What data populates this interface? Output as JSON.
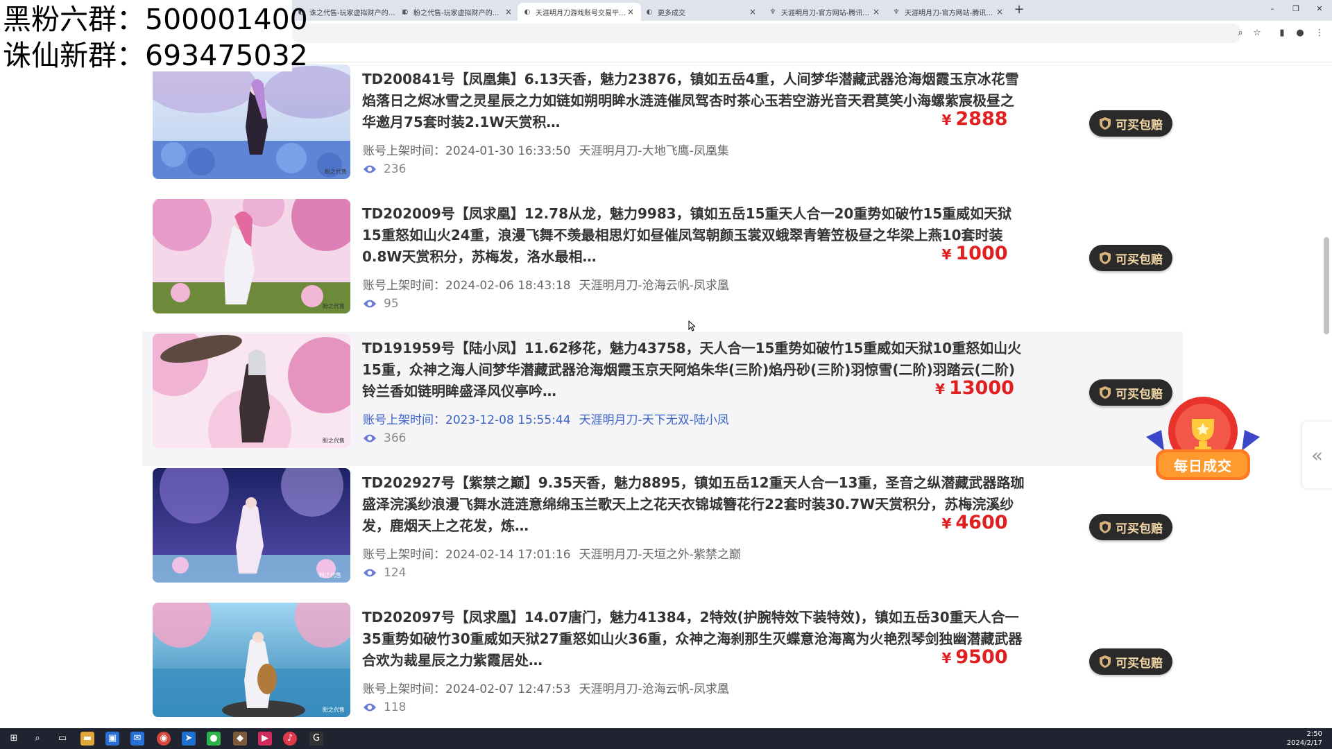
{
  "browser": {
    "tabs": [
      {
        "title": "诛之代售-玩家虚拟财产的守护者",
        "active": false
      },
      {
        "title": "盼之代售-玩家虚拟财产的守护者",
        "active": false
      },
      {
        "title": "天涯明月刀游戏账号交易平台_天涯",
        "active": true
      },
      {
        "title": "更多成交",
        "active": false
      },
      {
        "title": "天涯明月刀-官方网站-腾讯游戏",
        "active": false
      },
      {
        "title": "天涯明月刀-官方网站-腾讯游戏",
        "active": false
      }
    ],
    "new_tab_symbol": "+"
  },
  "overlay": {
    "line1": "黑粉六群：500001400",
    "line2": "诛仙新群：693475032"
  },
  "listing_meta_label": "账号上架时间：",
  "buy_button_label": "可买包赔",
  "currency_symbol": "¥",
  "listings": [
    {
      "title": "TD200841号【凤凰集】6.13天香，魅力23876，镇如五岳4重，人间梦华潜藏武器沧海烟霞玉京冰花雪焰落日之烬冰雪之灵星辰之力如链如朔明眸水涟涟催凤驾杏时茶心玉若空游光音天君莫笑小海螺紫宸极昼之华邀月75套时装2.1W天赏积…",
      "listed_time": "2024-01-30 16:33:50",
      "server": "天涯明月刀-大地飞鹰-凤凰集",
      "views": "236",
      "price": "2888",
      "thumb_palette": [
        "#c9d9f2",
        "#5f86d6",
        "#7b4aa8"
      ]
    },
    {
      "title": "TD202009号【凤求凰】12.78从龙，魅力9983，镇如五岳15重天人合一20重势如破竹15重威如天狱15重怒如山火24重，浪漫飞舞不羡最相思灯如昼催凤驾朝颜玉裳双蛾翠青箬笠极昼之华梁上燕10套时装0.8W天赏积分，苏梅发，洛水最相…",
      "listed_time": "2024-02-06 18:43:18",
      "server": "天涯明月刀-沧海云帆-凤求凰",
      "views": "95",
      "price": "1000",
      "thumb_palette": [
        "#f4c9e0",
        "#d86aa8",
        "#6c8a3a"
      ]
    },
    {
      "title": "TD191959号【陆小凤】11.62移花，魅力43758，天人合一15重势如破竹15重威如天狱10重怒如山火15重，众神之海人间梦华潜藏武器沧海烟霞玉京天阿焰朱华(三阶)焰丹砂(三阶)羽惊雪(二阶)羽踏云(二阶)铃兰香如链明眸盛泽风仪亭吟…",
      "listed_time": "2023-12-08 15:55:44",
      "server": "天涯明月刀-天下无双-陆小凤",
      "views": "366",
      "price": "13000",
      "thumb_palette": [
        "#f6d6e8",
        "#e07fb4",
        "#5a3e3a"
      ]
    },
    {
      "title": "TD202927号【紫禁之巅】9.35天香，魅力8895，镇如五岳12重天人合一13重，圣音之纵潜藏武器路珈盛泽浣溪纱浪漫飞舞水涟涟意绵绵玉兰歌天上之花天衣锦城簪花行22套时装30.7W天赏积分，苏梅浣溪纱发，鹿烟天上之花发，炼…",
      "listed_time": "2024-02-14 17:01:16",
      "server": "天涯明月刀-天垣之外-紫禁之巅",
      "views": "124",
      "price": "4600",
      "thumb_palette": [
        "#2b2f7a",
        "#7a6cc8",
        "#f0c0e6"
      ]
    },
    {
      "title": "TD202097号【凤求凰】14.07唐门，魅力41384，2特效(护腕特效下装特效)，镇如五岳30重天人合一35重势如破竹30重威如天狱27重怒如山火36重，众神之海刹那生灭蝶意沧海离为火艳烈琴剑独幽潜藏武器合欢为裁星辰之力紫霞居处…",
      "listed_time": "2024-02-07 12:47:53",
      "server": "天涯明月刀-沧海云帆-凤求凰",
      "views": "118",
      "price": "9500",
      "thumb_palette": [
        "#7fc4e8",
        "#f2a6c8",
        "#3a6f8f"
      ]
    }
  ],
  "daily_badge_label": "每日成交",
  "side_handle_symbol": "«",
  "taskbar": {
    "time": "2:50",
    "date": "2024/2/17"
  },
  "colors": {
    "price_red": "#e02020",
    "button_dark": "#2a2a2a",
    "button_gold_text": "#f3d7a6",
    "link_blue": "#3a62c9",
    "eye_icon": "#6b7bd6"
  }
}
